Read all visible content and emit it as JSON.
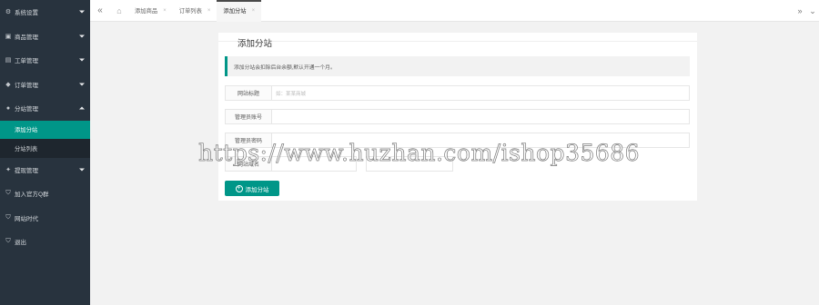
{
  "sidebar": {
    "items": [
      {
        "label": "系统设置",
        "icon": "gear-icon"
      },
      {
        "label": "商品管理",
        "icon": "box-icon"
      },
      {
        "label": "工单管理",
        "icon": "ticket-icon"
      },
      {
        "label": "订单管理",
        "icon": "stack-icon"
      },
      {
        "label": "分站管理",
        "icon": "circle-icon"
      },
      {
        "label": "提现管理",
        "icon": "wallet-icon"
      },
      {
        "label": "加入官方Q群",
        "icon": "shield-icon"
      },
      {
        "label": "网站时代",
        "icon": "shield-icon"
      },
      {
        "label": "退出",
        "icon": "shield-icon"
      }
    ],
    "sub_items": [
      {
        "label": "添加分站"
      },
      {
        "label": "分站列表"
      }
    ]
  },
  "tabs": [
    {
      "label": "添加商品"
    },
    {
      "label": "订单列表"
    },
    {
      "label": "添加分站"
    }
  ],
  "form": {
    "title": "添加分站",
    "notice": "添加分站会扣除后台余额,默认开通一个月。",
    "fields": [
      {
        "label": "网站标题",
        "placeholder": "如：某某商城"
      },
      {
        "label": "管理员账号",
        "placeholder": ""
      },
      {
        "label": "管理员密码",
        "placeholder": ""
      },
      {
        "label": "网站域名",
        "placeholder": ""
      }
    ],
    "submit_label": "添加分站"
  },
  "watermark": "https://www.huzhan.com/ishop35686",
  "colors": {
    "accent": "#009688",
    "sidebar_bg": "#28333e"
  }
}
